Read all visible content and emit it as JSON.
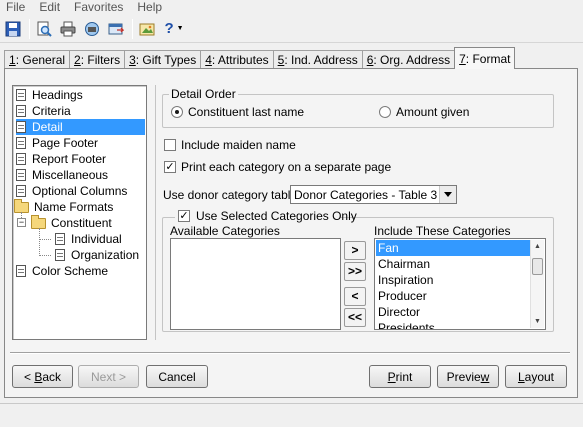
{
  "menubar": {
    "items": [
      "File",
      "Edit",
      "Favorites",
      "Help"
    ]
  },
  "toolbar": {
    "help_label": "?",
    "icons": [
      "save-icon",
      "print-preview-icon",
      "print-icon",
      "connect-icon",
      "export-icon",
      "image-icon",
      "help-icon"
    ]
  },
  "tabs": [
    {
      "key": "1",
      "label": ": General"
    },
    {
      "key": "2",
      "label": ": Filters"
    },
    {
      "key": "3",
      "label": ": Gift Types"
    },
    {
      "key": "4",
      "label": ": Attributes"
    },
    {
      "key": "5",
      "label": ": Ind. Address"
    },
    {
      "key": "6",
      "label": ": Org. Address"
    },
    {
      "key": "7",
      "label": ": Format"
    }
  ],
  "active_tab": "7: Format",
  "tree": {
    "items": [
      "Headings",
      "Criteria",
      "Detail",
      "Page Footer",
      "Report Footer",
      "Miscellaneous",
      "Optional Columns",
      "Name Formats",
      "Constituent",
      "Individual",
      "Organization",
      "Color Scheme"
    ],
    "selected": "Detail",
    "expander_symbol": "−"
  },
  "detail_order": {
    "title": "Detail Order",
    "option_constituent": "Constituent last name",
    "option_amount": "Amount given",
    "selected": "Constituent last name"
  },
  "options": {
    "include_maiden_name": "Include maiden name",
    "include_maiden_checked": false,
    "print_each_category": "Print each category on a separate page",
    "print_each_checked": true,
    "check_mark": "✓"
  },
  "donor_table": {
    "label": "Use donor category table:",
    "value": "Donor Categories - Table 3"
  },
  "categories": {
    "use_selected_label": "Use Selected Categories Only",
    "use_selected_checked": true,
    "available_label": "Available Categories",
    "available": [],
    "include_label": "Include These Categories",
    "include": [
      "Fan",
      "Chairman",
      "Inspiration",
      "Producer",
      "Director",
      "Presidents"
    ],
    "selected": "Fan",
    "move_buttons": {
      "add": ">",
      "add_all": ">>",
      "remove": "<",
      "remove_all": "<<"
    }
  },
  "buttons": {
    "back_key": "B",
    "back_rest": "ack",
    "back_prefix": "< ",
    "next": "Next >",
    "cancel": "Cancel",
    "print_key": "P",
    "print_rest": "rint",
    "preview_pre": "Previe",
    "preview_key": "w",
    "layout_key": "L",
    "layout_rest": "ayout"
  }
}
